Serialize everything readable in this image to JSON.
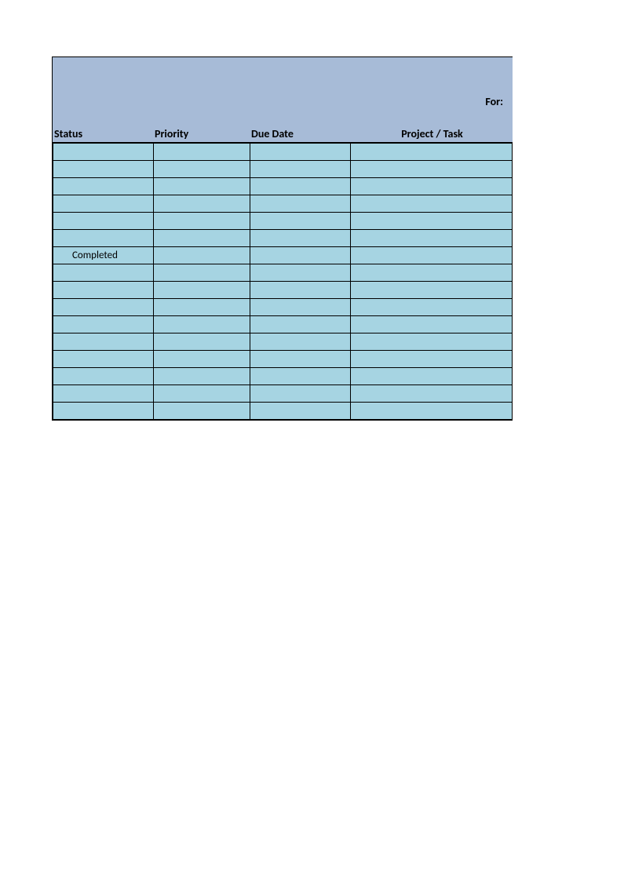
{
  "header": {
    "for_label": "For:"
  },
  "columns": {
    "status": "Status",
    "priority": "Priority",
    "due_date": "Due Date",
    "project_task": "Project / Task"
  },
  "rows": [
    {
      "status": "",
      "priority": "",
      "due_date": "",
      "task": ""
    },
    {
      "status": "",
      "priority": "",
      "due_date": "",
      "task": ""
    },
    {
      "status": "",
      "priority": "",
      "due_date": "",
      "task": ""
    },
    {
      "status": "",
      "priority": "",
      "due_date": "",
      "task": ""
    },
    {
      "status": "",
      "priority": "",
      "due_date": "",
      "task": ""
    },
    {
      "status": "",
      "priority": "",
      "due_date": "",
      "task": ""
    },
    {
      "status": "Completed",
      "priority": "",
      "due_date": "",
      "task": ""
    },
    {
      "status": "",
      "priority": "",
      "due_date": "",
      "task": ""
    },
    {
      "status": "",
      "priority": "",
      "due_date": "",
      "task": ""
    },
    {
      "status": "",
      "priority": "",
      "due_date": "",
      "task": ""
    },
    {
      "status": "",
      "priority": "",
      "due_date": "",
      "task": ""
    },
    {
      "status": "",
      "priority": "",
      "due_date": "",
      "task": ""
    },
    {
      "status": "",
      "priority": "",
      "due_date": "",
      "task": ""
    },
    {
      "status": "",
      "priority": "",
      "due_date": "",
      "task": ""
    },
    {
      "status": "",
      "priority": "",
      "due_date": "",
      "task": ""
    },
    {
      "status": "",
      "priority": "",
      "due_date": "",
      "task": ""
    }
  ]
}
